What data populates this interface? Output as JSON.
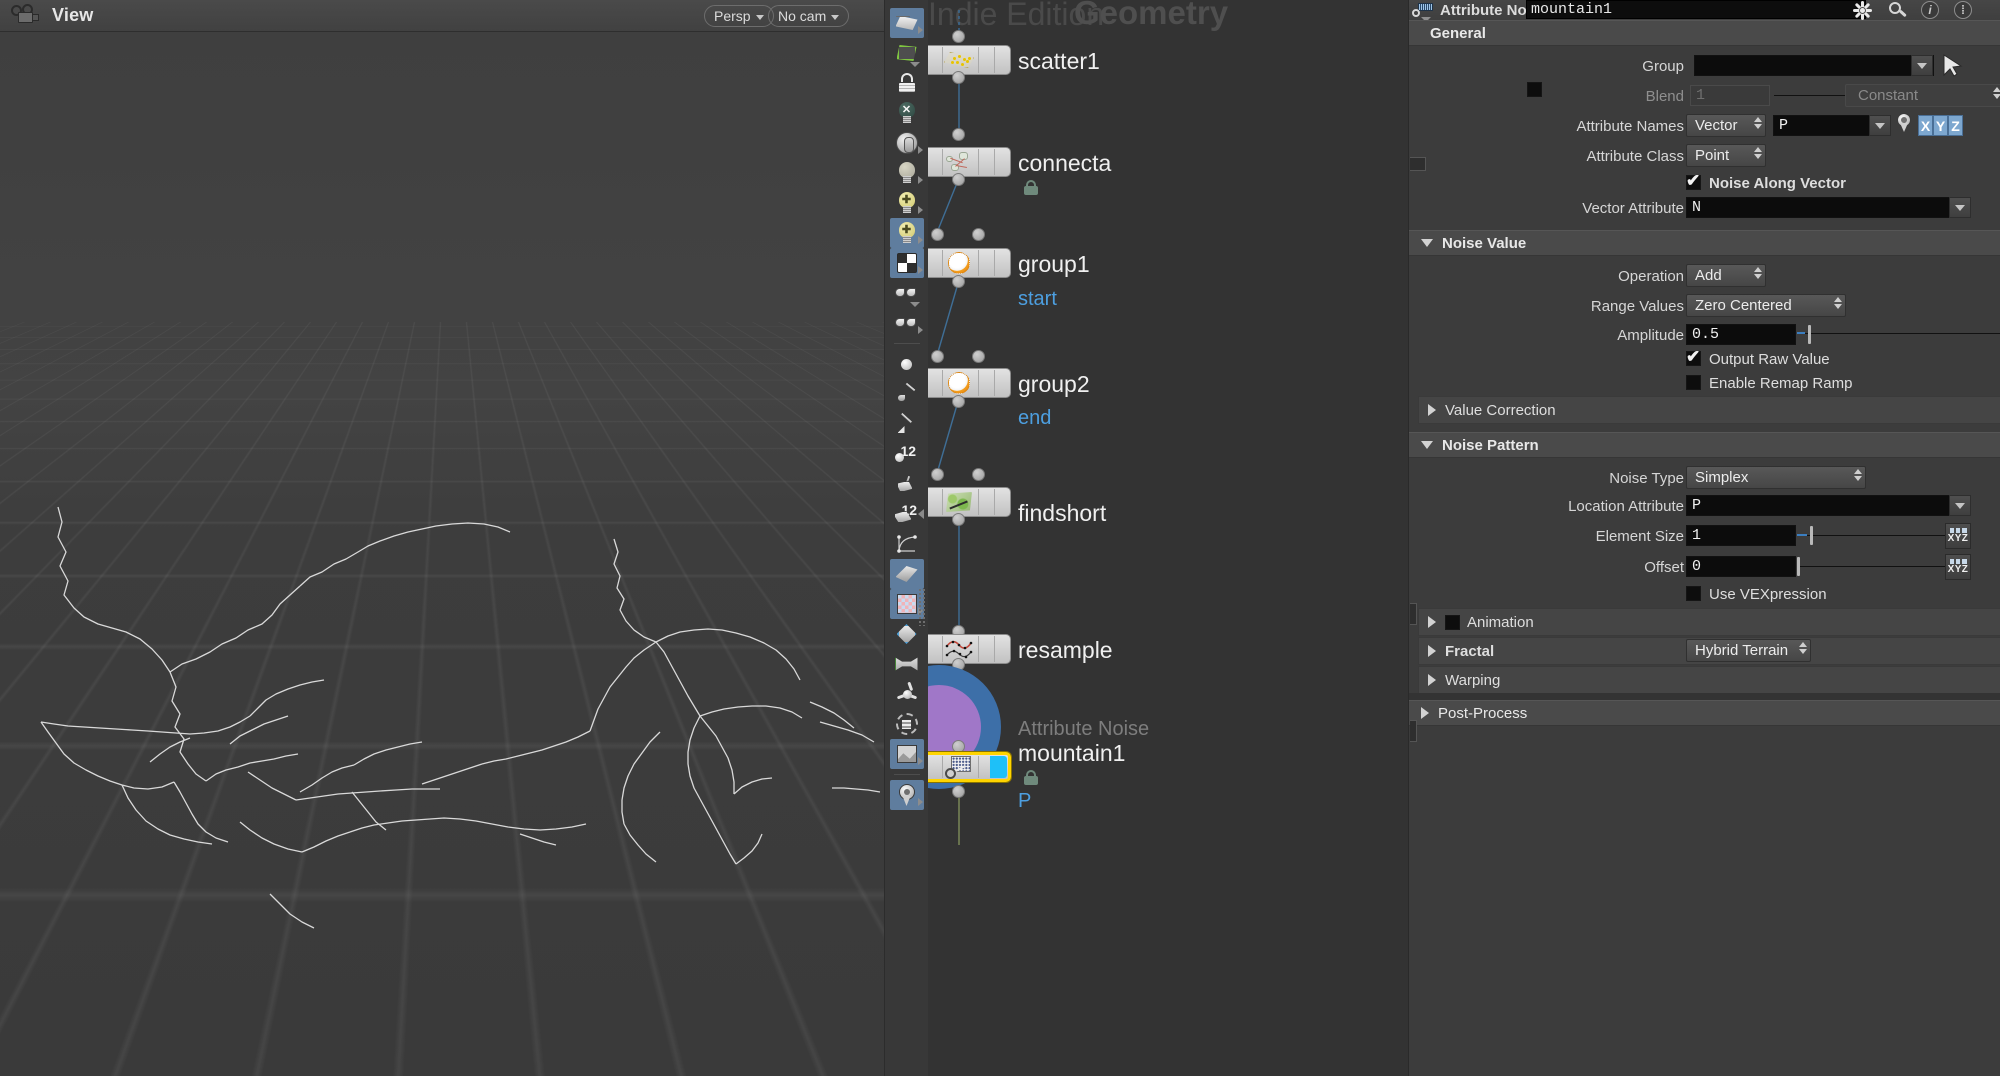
{
  "viewport": {
    "camera_icon": "camera-icon",
    "title": "View",
    "persp_label": "Persp",
    "nocam_label": "No cam"
  },
  "view_toolbar": {
    "items": [
      {
        "name": "select-plane-tool",
        "icon": "plane-select-icon",
        "active": true
      },
      {
        "name": "snap-to-geometry",
        "icon": "green-quad-snap-icon",
        "active": false
      },
      {
        "name": "lock-selection",
        "icon": "padlock-icon",
        "active": false
      },
      {
        "name": "headlight-off",
        "icon": "bulb-x-icon",
        "active": false
      },
      {
        "name": "display-shading",
        "icon": "disc-shading-icon",
        "active": false
      },
      {
        "name": "light-normal",
        "icon": "bulb-plain-icon",
        "active": false
      },
      {
        "name": "light-add",
        "icon": "bulb-plus-icon",
        "active": false
      },
      {
        "name": "light-add-shadow",
        "icon": "bulb-plus-shadow-icon",
        "active": true
      },
      {
        "name": "material-display",
        "icon": "checker-cube-icon",
        "active": true
      },
      {
        "name": "ghost-display",
        "icon": "glasses-icon",
        "active": false
      },
      {
        "name": "ghost-playback",
        "icon": "glasses-play-icon",
        "active": false
      },
      {
        "name": "point-display",
        "icon": "point-dot-icon",
        "active": false
      },
      {
        "name": "brush-tool",
        "icon": "brush-icon",
        "active": false
      },
      {
        "name": "pen-tool",
        "icon": "pen-icon",
        "active": false
      },
      {
        "name": "point-numbers",
        "icon": "twelve-point-icon",
        "active": false
      },
      {
        "name": "primitive-tool",
        "icon": "trowel-icon",
        "active": false
      },
      {
        "name": "primitive-numbers",
        "icon": "twelve-prim-icon",
        "active": false
      },
      {
        "name": "curve-display",
        "icon": "curve-icon",
        "active": false
      },
      {
        "name": "geometry-display",
        "icon": "book-plane-icon",
        "active": true
      },
      {
        "name": "texture-display",
        "icon": "checker-square-icon",
        "active": true
      },
      {
        "name": "diamond-display",
        "icon": "diamond-icon",
        "active": false
      },
      {
        "name": "selection-hull",
        "icon": "green-hull-icon",
        "active": false
      },
      {
        "name": "axis-display",
        "icon": "tripod-icon",
        "active": false
      },
      {
        "name": "volume-display",
        "icon": "dashed-circle-icon",
        "active": false
      },
      {
        "name": "background-image",
        "icon": "image-mount-icon",
        "active": true
      },
      {
        "name": "marker-display",
        "icon": "map-pin-icon",
        "active": true
      }
    ]
  },
  "network": {
    "watermark": "Indie Edition",
    "title": "Geometry",
    "nodes": [
      {
        "name": "scatter1",
        "type": "",
        "icon": "scatter-icon",
        "sub": "",
        "locked": false,
        "selected": false,
        "flag": false
      },
      {
        "name": "connecta",
        "type": "",
        "icon": "connect-adjacent-icon",
        "sub": "",
        "locked": true,
        "selected": false,
        "flag": false
      },
      {
        "name": "group1",
        "type": "",
        "icon": "group-icon",
        "sub": "start",
        "locked": false,
        "selected": false,
        "flag": false
      },
      {
        "name": "group2",
        "type": "",
        "icon": "group-icon",
        "sub": "end",
        "locked": false,
        "selected": false,
        "flag": false
      },
      {
        "name": "findshort",
        "type": "",
        "icon": "find-shortest-path-icon",
        "sub": "",
        "locked": false,
        "selected": false,
        "flag": false
      },
      {
        "name": "resample",
        "type": "",
        "icon": "resample-icon",
        "sub": "",
        "locked": false,
        "selected": false,
        "flag": false
      },
      {
        "name": "mountain1",
        "type": "Attribute Noise",
        "icon": "attribute-noise-icon",
        "sub": "P",
        "locked": true,
        "selected": true,
        "flag": true
      }
    ]
  },
  "params": {
    "node_type": "Attribute Noise",
    "node_name": "mountain1",
    "header_icons": [
      "gear-icon",
      "search-icon",
      "info-icon",
      "help-icon"
    ],
    "sections": {
      "general": {
        "label": "General",
        "group": {
          "label": "Group",
          "value": "",
          "placeholder": ""
        },
        "blend": {
          "label": "Blend",
          "value": "1",
          "mode": "Constant",
          "enabled": false
        },
        "attribute_names": {
          "label": "Attribute Names",
          "kind": "Vector",
          "value": "P",
          "axes": [
            "X",
            "Y",
            "Z"
          ],
          "axes_on": [
            true,
            true,
            true
          ]
        },
        "attribute_class": {
          "label": "Attribute Class",
          "value": "Point"
        },
        "noise_along_vector": {
          "label": "Noise Along Vector",
          "checked": true
        },
        "vector_attribute": {
          "label": "Vector Attribute",
          "value": "N"
        }
      },
      "noise_value": {
        "label": "Noise Value",
        "operation": {
          "label": "Operation",
          "value": "Add"
        },
        "range_values": {
          "label": "Range Values",
          "value": "Zero Centered"
        },
        "amplitude": {
          "label": "Amplitude",
          "value": "0.5"
        },
        "output_raw_value": {
          "label": "Output Raw Value",
          "checked": true
        },
        "enable_remap_ramp": {
          "label": "Enable Remap Ramp",
          "checked": false
        },
        "value_correction": {
          "label": "Value Correction",
          "expanded": false
        }
      },
      "noise_pattern": {
        "label": "Noise Pattern",
        "noise_type": {
          "label": "Noise Type",
          "value": "Simplex"
        },
        "location_attribute": {
          "label": "Location Attribute",
          "value": "P"
        },
        "element_size": {
          "label": "Element Size",
          "value": "1"
        },
        "offset": {
          "label": "Offset",
          "value": "0"
        },
        "use_vexpression": {
          "label": "Use VEXpression",
          "checked": false
        },
        "animation": {
          "label": "Animation",
          "expanded": false,
          "checked": false
        },
        "fractal": {
          "label": "Fractal",
          "expanded": false,
          "value": "Hybrid Terrain"
        },
        "warping": {
          "label": "Warping",
          "expanded": false
        }
      },
      "post_process": {
        "label": "Post-Process",
        "expanded": false
      }
    }
  },
  "colors": {
    "accent_blue": "#5f7d9e",
    "selected_node": "#ffd400",
    "flag_cyan": "#1ec0f8",
    "link_blue": "#4d9fe0",
    "panel_bg": "#3c3c3c",
    "network_bg": "#333333",
    "slider_blue": "#3b7ec0",
    "lock_green": "#6f8a7c"
  }
}
